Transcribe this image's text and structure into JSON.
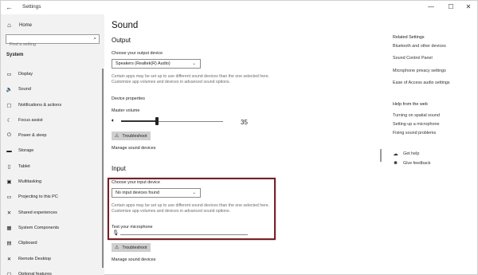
{
  "window": {
    "title": "Settings",
    "back_icon": "back-arrow-icon",
    "minimize_glyph": "—",
    "maximize_glyph": "☐",
    "close_glyph": "✕"
  },
  "sidebar": {
    "home_label": "Home",
    "search_placeholder": "Find a setting",
    "section_label": "System",
    "items": [
      {
        "label": "Display",
        "icon": "display-icon",
        "glyph": "▭"
      },
      {
        "label": "Sound",
        "icon": "speaker-icon",
        "glyph": "🔈"
      },
      {
        "label": "Notifications & actions",
        "icon": "notifications-icon",
        "glyph": "▢"
      },
      {
        "label": "Focus assist",
        "icon": "moon-icon",
        "glyph": "☾"
      },
      {
        "label": "Power & sleep",
        "icon": "power-icon",
        "glyph": "⏻"
      },
      {
        "label": "Storage",
        "icon": "storage-icon",
        "glyph": "▬"
      },
      {
        "label": "Tablet",
        "icon": "tablet-icon",
        "glyph": "▯"
      },
      {
        "label": "Multitasking",
        "icon": "multitasking-icon",
        "glyph": "▣"
      },
      {
        "label": "Projecting to this PC",
        "icon": "projecting-icon",
        "glyph": "▭"
      },
      {
        "label": "Shared experiences",
        "icon": "shared-icon",
        "glyph": "✕"
      },
      {
        "label": "System Components",
        "icon": "components-icon",
        "glyph": "▦"
      },
      {
        "label": "Clipboard",
        "icon": "clipboard-icon",
        "glyph": "▤"
      },
      {
        "label": "Remote Desktop",
        "icon": "remote-desktop-icon",
        "glyph": "✕"
      },
      {
        "label": "Optional features",
        "icon": "optional-features-icon",
        "glyph": "▢"
      }
    ]
  },
  "main": {
    "title": "Sound",
    "output": {
      "heading": "Output",
      "choose_label": "Choose your output device",
      "device_value": "Speakers (Realtek(R) Audio)",
      "help_text": "Certain apps may be set up to use different sound devices than the one selected here. Customize app volumes and devices in advanced sound options.",
      "properties_link": "Device properties",
      "master_volume_label": "Master volume",
      "volume_value": "35",
      "volume_level": 0.35,
      "troubleshoot_label": "Troubleshoot",
      "manage_link": "Manage sound devices"
    },
    "input": {
      "heading": "Input",
      "choose_label": "Choose your input device",
      "device_value": "No input devices found",
      "help_text": "Certain apps may be set up to use different sound devices than the one selected here. Customize app volumes and devices in advanced sound options.",
      "test_label": "Test your microphone",
      "troubleshoot_label": "Troubleshoot",
      "manage_link": "Manage sound devices"
    }
  },
  "rail": {
    "related_heading": "Related Settings",
    "related_links": [
      "Bluetooth and other devices",
      "Sound Control Panel",
      "Microphone privacy settings",
      "Ease of Access audio settings"
    ],
    "help_heading": "Help from the web",
    "help_links": [
      "Turning on spatial sound",
      "Setting up a microphone",
      "Fixing sound problems"
    ],
    "get_help": "Get help",
    "give_feedback": "Give feedback"
  },
  "colors": {
    "highlight_border": "#7a1f25",
    "sidebar_bg": "#f2f2f2",
    "button_bg": "#cfcfcf"
  }
}
